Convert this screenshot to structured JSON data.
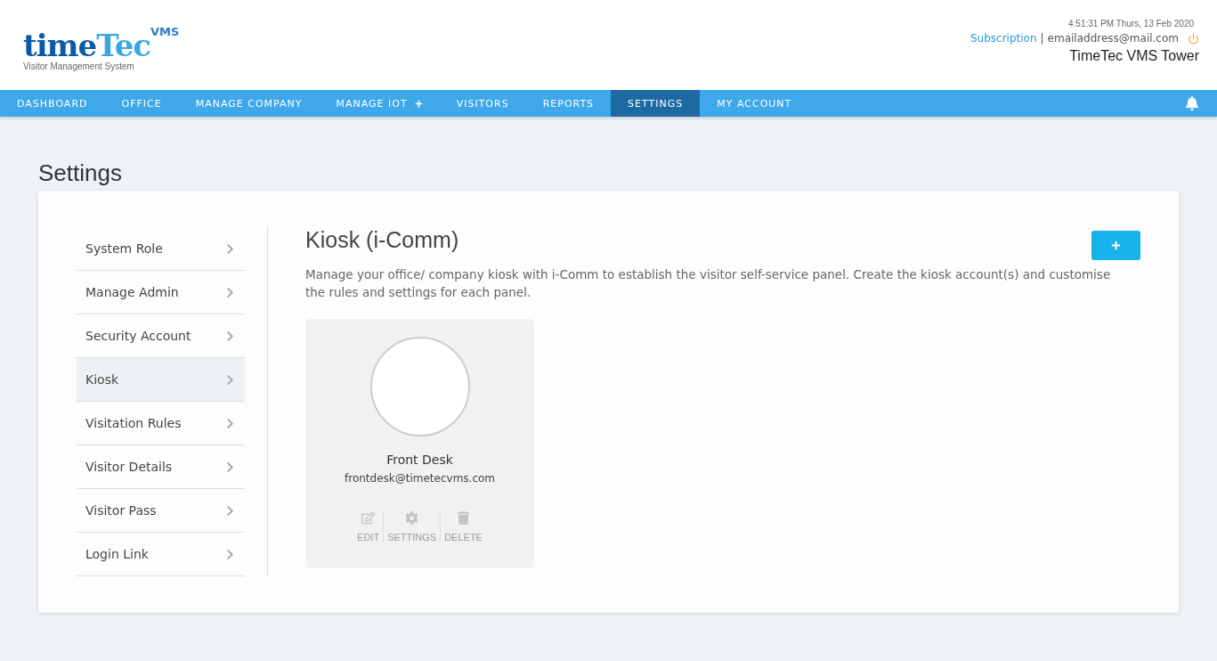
{
  "logo": {
    "word_dark": "time",
    "word_light": "Tec",
    "suffix": "VMS",
    "tagline": "Visitor Management System"
  },
  "header": {
    "datetime": "4:51:31 PM  Thurs, 13 Feb 2020",
    "subscription_link": "Subscription",
    "separator": "|",
    "email": "emailaddress@mail.com",
    "building": "TimeTec VMS Tower"
  },
  "nav": [
    {
      "label": "DASHBOARD",
      "selected": false,
      "expandable": false
    },
    {
      "label": "OFFICE",
      "selected": false,
      "expandable": false
    },
    {
      "label": "MANAGE COMPANY",
      "selected": false,
      "expandable": false
    },
    {
      "label": "MANAGE IOT",
      "selected": false,
      "expandable": true
    },
    {
      "label": "VISITORS",
      "selected": false,
      "expandable": false
    },
    {
      "label": "REPORTS",
      "selected": false,
      "expandable": false
    },
    {
      "label": "SETTINGS",
      "selected": true,
      "expandable": false
    },
    {
      "label": "MY ACCOUNT",
      "selected": false,
      "expandable": false
    }
  ],
  "page_title": "Settings",
  "sidebar": [
    {
      "label": "System Role",
      "selected": false
    },
    {
      "label": "Manage Admin",
      "selected": false
    },
    {
      "label": "Security Account",
      "selected": false
    },
    {
      "label": "Kiosk",
      "selected": true
    },
    {
      "label": "Visitation Rules",
      "selected": false
    },
    {
      "label": "Visitor Details",
      "selected": false
    },
    {
      "label": "Visitor Pass",
      "selected": false
    },
    {
      "label": "Login Link",
      "selected": false
    }
  ],
  "section": {
    "title": "Kiosk (i-Comm)",
    "description": "Manage your office/ company kiosk with i-Comm to establish the visitor self-service panel. Create the kiosk account(s) and customise the rules and settings for each panel."
  },
  "kiosks": [
    {
      "name": "Front Desk",
      "email": "frontdesk@timetecvms.com",
      "actions": [
        {
          "kind": "edit",
          "label": "EDIT"
        },
        {
          "kind": "settings",
          "label": "SETTINGS"
        },
        {
          "kind": "delete",
          "label": "DELETE"
        }
      ]
    }
  ]
}
